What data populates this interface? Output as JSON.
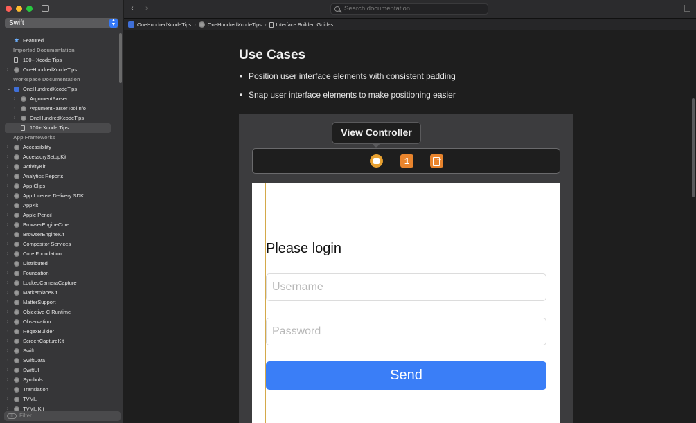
{
  "sidebar": {
    "language": "Swift",
    "filter_placeholder": "Filter",
    "items": [
      {
        "label": "Featured",
        "type": "star",
        "level": 1,
        "chevron": ""
      },
      {
        "label": "Imported Documentation",
        "type": "section"
      },
      {
        "label": "100+ Xcode Tips",
        "type": "doc",
        "level": 1,
        "chevron": ""
      },
      {
        "label": "OneHundredXcodeTips",
        "type": "stack",
        "level": 1,
        "chevron": "›"
      },
      {
        "label": "Workspace Documentation",
        "type": "section"
      },
      {
        "label": "OneHundredXcodeTips",
        "type": "blue",
        "level": 1,
        "chevron": "⌄"
      },
      {
        "label": "ArgumentParser",
        "type": "stack",
        "level": 2,
        "chevron": "›"
      },
      {
        "label": "ArgumentParserToolInfo",
        "type": "stack",
        "level": 2,
        "chevron": "›"
      },
      {
        "label": "OneHundredXcodeTips",
        "type": "stack",
        "level": 2,
        "chevron": "›"
      },
      {
        "label": "100+ Xcode Tips",
        "type": "doc",
        "level": 2,
        "chevron": "",
        "selected": true
      },
      {
        "label": "App Frameworks",
        "type": "section"
      },
      {
        "label": "Accessibility",
        "type": "stack",
        "level": 1,
        "chevron": "›"
      },
      {
        "label": "AccessorySetupKit",
        "type": "stack",
        "level": 1,
        "chevron": "›"
      },
      {
        "label": "ActivityKit",
        "type": "stack",
        "level": 1,
        "chevron": "›"
      },
      {
        "label": "Analytics Reports",
        "type": "stack",
        "level": 1,
        "chevron": "›"
      },
      {
        "label": "App Clips",
        "type": "stack",
        "level": 1,
        "chevron": "›"
      },
      {
        "label": "App License Delivery SDK",
        "type": "stack",
        "level": 1,
        "chevron": "›"
      },
      {
        "label": "AppKit",
        "type": "stack",
        "level": 1,
        "chevron": "›"
      },
      {
        "label": "Apple Pencil",
        "type": "stack",
        "level": 1,
        "chevron": "›"
      },
      {
        "label": "BrowserEngineCore",
        "type": "stack",
        "level": 1,
        "chevron": "›"
      },
      {
        "label": "BrowserEngineKit",
        "type": "stack",
        "level": 1,
        "chevron": "›"
      },
      {
        "label": "Compositor Services",
        "type": "stack",
        "level": 1,
        "chevron": "›"
      },
      {
        "label": "Core Foundation",
        "type": "stack",
        "level": 1,
        "chevron": "›"
      },
      {
        "label": "Distributed",
        "type": "stack",
        "level": 1,
        "chevron": "›"
      },
      {
        "label": "Foundation",
        "type": "stack",
        "level": 1,
        "chevron": "›"
      },
      {
        "label": "LockedCameraCapture",
        "type": "stack",
        "level": 1,
        "chevron": "›"
      },
      {
        "label": "MarketplaceKit",
        "type": "stack",
        "level": 1,
        "chevron": "›"
      },
      {
        "label": "MatterSupport",
        "type": "stack",
        "level": 1,
        "chevron": "›"
      },
      {
        "label": "Objective-C Runtime",
        "type": "stack",
        "level": 1,
        "chevron": "›"
      },
      {
        "label": "Observation",
        "type": "stack",
        "level": 1,
        "chevron": "›"
      },
      {
        "label": "RegexBuilder",
        "type": "stack",
        "level": 1,
        "chevron": "›"
      },
      {
        "label": "ScreenCaptureKit",
        "type": "stack",
        "level": 1,
        "chevron": "›"
      },
      {
        "label": "Swift",
        "type": "stack",
        "level": 1,
        "chevron": "›"
      },
      {
        "label": "SwiftData",
        "type": "stack",
        "level": 1,
        "chevron": "›"
      },
      {
        "label": "SwiftUI",
        "type": "stack",
        "level": 1,
        "chevron": "›"
      },
      {
        "label": "Symbols",
        "type": "stack",
        "level": 1,
        "chevron": "›"
      },
      {
        "label": "Translation",
        "type": "stack",
        "level": 1,
        "chevron": "›"
      },
      {
        "label": "TVML",
        "type": "stack",
        "level": 1,
        "chevron": "›"
      },
      {
        "label": "TVML Kit",
        "type": "stack",
        "level": 1,
        "chevron": "›"
      }
    ]
  },
  "toolbar": {
    "back_icon": "‹",
    "forward_icon": "›",
    "search_placeholder": "Search documentation"
  },
  "breadcrumb": {
    "items": [
      "OneHundredXcodeTips",
      "OneHundredXcodeTips",
      "Interface Builder: Guides"
    ],
    "separator": "›"
  },
  "content": {
    "heading": "Use Cases",
    "bullets": [
      "Position user interface elements with consistent padding",
      "Snap user interface elements to make positioning easier"
    ],
    "figure": {
      "tooltip": "View Controller",
      "badge_number": "1",
      "login_title": "Please login",
      "username_placeholder": "Username",
      "password_placeholder": "Password",
      "send_label": "Send"
    }
  },
  "colors": {
    "accent": "#3a7ef7",
    "guide": "#d4a94a",
    "vc_orange": "#e8842d"
  }
}
